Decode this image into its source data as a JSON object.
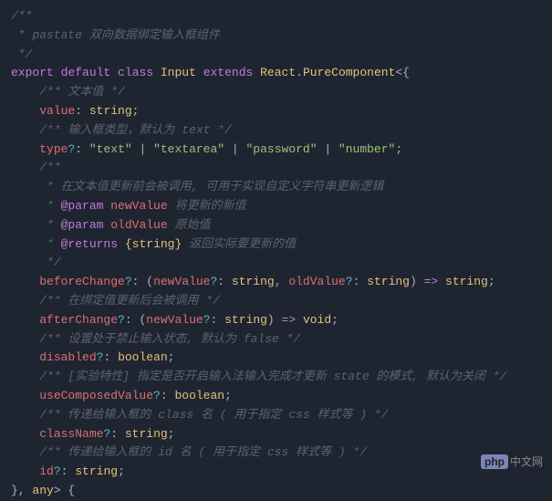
{
  "code": {
    "line1": "/**",
    "line2": " * pastate 双向数据绑定输入框组件",
    "line3": " */",
    "line4_kw_export": "export",
    "line4_kw_default": "default",
    "line4_kw_class": "class",
    "line4_class_input": "Input",
    "line4_kw_extends": "extends",
    "line4_class_react": "React",
    "line4_class_pc": "PureComponent",
    "comment_value": "/** 文本值 */",
    "prop_value": "value",
    "type_string": "string",
    "comment_type": "/** 输入框类型，默认为 text */",
    "prop_type": "type",
    "str_text": "\"text\"",
    "str_textarea": "\"textarea\"",
    "str_password": "\"password\"",
    "str_number": "\"number\"",
    "bc_open": "/**",
    "bc_line1": " * 在文本值更新前会被调用, 可用于实现自定义字符串更新逻辑",
    "bc_param_tag": "@param",
    "bc_param1_name": "newValue",
    "bc_param1_desc": " 将更新的新值",
    "bc_param2_name": "oldValue",
    "bc_param2_desc": " 原始值",
    "bc_returns_tag": "@returns",
    "bc_returns_type": "{string}",
    "bc_returns_desc": " 返回实际要更新的值",
    "bc_close": " */",
    "prop_beforeChange": "beforeChange",
    "param_newValue": "newValue",
    "param_oldValue": "oldValue",
    "comment_afterChange": "/** 在绑定值更新后会被调用 */",
    "prop_afterChange": "afterChange",
    "type_void": "void",
    "comment_disabled": "/** 设置处于禁止输入状态, 默认为 false */",
    "prop_disabled": "disabled",
    "type_boolean": "boolean",
    "comment_useComposed": "/** [实验特性] 指定是否开启输入法输入完成才更新 state 的模式, 默认为关闭 */",
    "prop_useComposed": "useComposedValue",
    "comment_className": "/** 传递给输入框的 class 名 ( 用于指定 css 样式等 ) */",
    "prop_className": "className",
    "comment_id": "/** 传递给输入框的 id 名 ( 用于指定 css 样式等 ) */",
    "prop_id": "id",
    "type_any": "any",
    "arrow": "=>"
  },
  "watermark": {
    "badge": "php",
    "text": "中文网"
  }
}
